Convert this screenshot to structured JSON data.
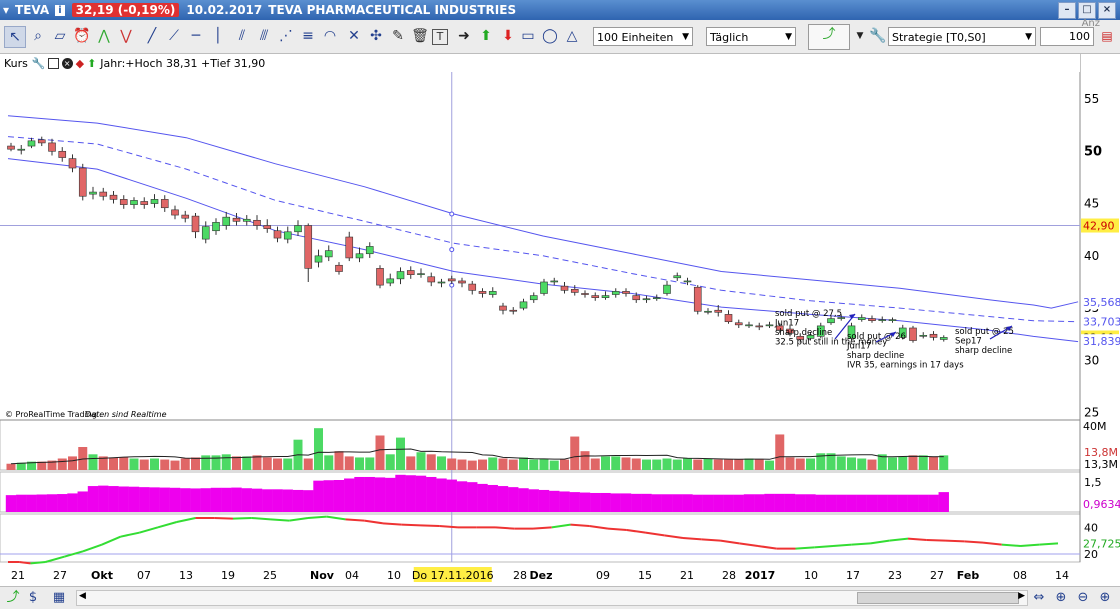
{
  "window": {
    "symbol": "TEVA",
    "price_badge": "32,19 (-0,19%)",
    "date": "10.02.2017",
    "instrument": "TEVA PHARMACEUTICAL INDUSTRIES"
  },
  "toolbar": {
    "units_select": "100 Einheiten",
    "period_select": "Täglich",
    "strategy_select": "Strategie [T0,S0]",
    "quantity_label": "Anz",
    "quantity_value": "100"
  },
  "chart_header": {
    "label": "Kurs",
    "year_stats": "Jahr:+Hoch 38,31 +Tief 31,90"
  },
  "watermark": "© ProRealTime Trading",
  "watermark_italic": "Daten sind Realtime",
  "colors": {
    "up": "#4cd964",
    "down": "#e06666",
    "band": "#5555ee",
    "volume_ma": "#222222",
    "indicator": "#ee00ee",
    "osc_up": "#33dd33",
    "osc_down": "#ee3333",
    "bg": "#ffffff",
    "grid": "#d8d8e8"
  },
  "chart_data": [
    {
      "type": "candlestick",
      "y_axis_ticks": [
        25,
        30,
        35,
        40,
        45,
        50,
        55
      ],
      "ylim": [
        24.3,
        57.2
      ],
      "price_labels": [
        {
          "value": 42.9,
          "text": "42,90",
          "style": "horizontal"
        },
        {
          "value": 35.568,
          "text": "35,568",
          "style": "band"
        },
        {
          "value": 33.703,
          "text": "33,703",
          "style": "band"
        },
        {
          "value": 32.19,
          "text": "32,19",
          "style": "last"
        },
        {
          "value": 31.839,
          "text": "31,839",
          "style": "band"
        }
      ],
      "horizontal_line": 42.9,
      "candles": [
        [
          50.5,
          50.2,
          50.8,
          50.0
        ],
        [
          50.1,
          50.2,
          50.6,
          49.7
        ],
        [
          50.5,
          51.0,
          51.3,
          50.3
        ],
        [
          51.1,
          50.8,
          51.4,
          50.5
        ],
        [
          50.8,
          50.0,
          51.2,
          49.6
        ],
        [
          50.0,
          49.4,
          50.4,
          49.0
        ],
        [
          49.3,
          48.4,
          49.7,
          48.0
        ],
        [
          48.4,
          45.7,
          48.8,
          45.3
        ],
        [
          45.9,
          46.1,
          46.6,
          45.4
        ],
        [
          46.1,
          45.7,
          46.5,
          45.3
        ],
        [
          45.8,
          45.4,
          46.2,
          45.0
        ],
        [
          45.4,
          44.9,
          45.8,
          44.5
        ],
        [
          44.9,
          45.3,
          45.6,
          44.5
        ],
        [
          45.2,
          44.9,
          45.6,
          44.5
        ],
        [
          45.0,
          45.4,
          45.9,
          44.6
        ],
        [
          45.4,
          44.6,
          45.8,
          44.2
        ],
        [
          44.4,
          43.9,
          44.8,
          43.5
        ],
        [
          43.9,
          43.6,
          44.3,
          43.2
        ],
        [
          43.8,
          42.3,
          44.1,
          41.7
        ],
        [
          41.6,
          42.8,
          43.3,
          41.2
        ],
        [
          42.4,
          43.2,
          43.6,
          42.0
        ],
        [
          42.9,
          43.7,
          44.2,
          42.5
        ],
        [
          43.6,
          43.3,
          44.1,
          42.9
        ],
        [
          43.3,
          43.5,
          43.9,
          42.9
        ],
        [
          43.4,
          42.9,
          43.9,
          42.5
        ],
        [
          42.9,
          42.6,
          43.5,
          42.2
        ],
        [
          42.4,
          41.7,
          42.8,
          41.3
        ],
        [
          41.6,
          42.3,
          42.8,
          41.2
        ],
        [
          42.3,
          42.9,
          43.4,
          41.9
        ],
        [
          42.9,
          38.8,
          43.1,
          37.5
        ],
        [
          39.4,
          40.0,
          40.6,
          38.9
        ],
        [
          39.9,
          40.5,
          41.0,
          39.5
        ],
        [
          39.1,
          38.5,
          39.4,
          38.2
        ],
        [
          41.8,
          39.8,
          42.3,
          39.5
        ],
        [
          39.8,
          40.2,
          40.8,
          39.4
        ],
        [
          40.2,
          40.9,
          41.3,
          39.8
        ],
        [
          38.8,
          37.2,
          39.1,
          36.9
        ],
        [
          37.4,
          37.8,
          38.3,
          37.1
        ],
        [
          37.8,
          38.5,
          38.9,
          37.3
        ],
        [
          38.6,
          38.2,
          39.0,
          37.8
        ],
        [
          38.3,
          38.3,
          38.8,
          37.9
        ],
        [
          38.0,
          37.5,
          38.4,
          37.1
        ],
        [
          37.4,
          37.5,
          37.8,
          37.0
        ],
        [
          37.8,
          37.6,
          38.1,
          37.3
        ],
        [
          37.6,
          37.4,
          37.9,
          37.0
        ],
        [
          37.3,
          36.7,
          37.6,
          36.3
        ],
        [
          36.6,
          36.4,
          36.9,
          36.0
        ],
        [
          36.3,
          36.6,
          37.0,
          36.0
        ],
        [
          35.2,
          34.8,
          35.5,
          34.4
        ],
        [
          34.8,
          34.7,
          35.1,
          34.4
        ],
        [
          35.0,
          35.6,
          35.9,
          34.8
        ],
        [
          35.8,
          36.2,
          36.5,
          35.5
        ],
        [
          36.4,
          37.5,
          37.8,
          36.2
        ],
        [
          37.5,
          37.6,
          37.9,
          37.2
        ],
        [
          37.1,
          36.7,
          37.5,
          36.4
        ],
        [
          36.8,
          36.5,
          37.2,
          36.2
        ],
        [
          36.4,
          36.3,
          36.7,
          36.0
        ],
        [
          36.2,
          36.0,
          36.5,
          35.7
        ],
        [
          36.0,
          36.2,
          36.6,
          35.8
        ],
        [
          36.3,
          36.6,
          36.9,
          36.0
        ],
        [
          36.6,
          36.4,
          36.9,
          36.1
        ],
        [
          36.2,
          35.8,
          36.5,
          35.5
        ],
        [
          35.8,
          35.9,
          36.2,
          35.5
        ],
        [
          35.9,
          36.0,
          36.3,
          35.7
        ],
        [
          36.4,
          37.2,
          37.6,
          36.2
        ],
        [
          37.9,
          38.1,
          38.4,
          37.6
        ],
        [
          37.6,
          37.6,
          37.9,
          37.2
        ],
        [
          37.0,
          34.7,
          37.2,
          34.4
        ],
        [
          34.7,
          34.7,
          35.0,
          34.4
        ],
        [
          34.8,
          34.6,
          35.3,
          34.2
        ],
        [
          34.4,
          33.7,
          34.8,
          33.5
        ],
        [
          33.6,
          33.4,
          33.9,
          33.1
        ],
        [
          33.4,
          33.4,
          33.7,
          33.1
        ],
        [
          33.3,
          33.2,
          33.6,
          32.9
        ],
        [
          33.4,
          33.4,
          33.7,
          33.1
        ],
        [
          33.3,
          32.9,
          33.6,
          32.6
        ],
        [
          33.0,
          32.6,
          33.3,
          32.3
        ],
        [
          32.3,
          32.0,
          32.6,
          31.7
        ],
        [
          32.1,
          32.4,
          32.7,
          31.9
        ],
        [
          32.3,
          33.3,
          33.6,
          32.1
        ],
        [
          33.6,
          34.0,
          34.3,
          33.4
        ],
        [
          34.0,
          34.1,
          34.4,
          33.8
        ],
        [
          32.1,
          33.3,
          33.6,
          31.9
        ],
        [
          33.9,
          34.1,
          34.4,
          33.7
        ],
        [
          34.0,
          33.8,
          34.3,
          33.6
        ],
        [
          33.9,
          33.9,
          34.2,
          33.6
        ],
        [
          33.8,
          33.9,
          34.1,
          33.6
        ],
        [
          32.2,
          33.1,
          33.4,
          32.0
        ],
        [
          33.1,
          31.9,
          33.3,
          31.7
        ],
        [
          32.4,
          32.4,
          32.7,
          32.1
        ],
        [
          32.5,
          32.2,
          32.8,
          31.9
        ],
        [
          32.0,
          32.2,
          32.4,
          31.8
        ]
      ],
      "upper_band": [
        [
          0,
          53.4
        ],
        [
          10,
          52.7
        ],
        [
          20,
          51.3
        ],
        [
          30,
          48.8
        ],
        [
          40,
          46.6
        ],
        [
          50,
          44.0
        ],
        [
          60,
          41.9
        ],
        [
          70,
          40.2
        ],
        [
          80,
          38.5
        ],
        [
          90,
          37.7
        ],
        [
          100,
          36.9
        ],
        [
          110,
          35.8
        ],
        [
          115,
          35.3
        ],
        [
          117,
          35.0
        ],
        [
          120,
          35.6
        ]
      ],
      "middle_band": [
        [
          0,
          51.4
        ],
        [
          10,
          50.7
        ],
        [
          20,
          48.3
        ],
        [
          30,
          45.3
        ],
        [
          40,
          43.3
        ],
        [
          50,
          41.2
        ],
        [
          60,
          40.0
        ],
        [
          70,
          38.3
        ],
        [
          80,
          36.7
        ],
        [
          90,
          35.7
        ],
        [
          100,
          35.0
        ],
        [
          110,
          34.2
        ],
        [
          115,
          33.8
        ],
        [
          120,
          33.7
        ]
      ],
      "lower_band": [
        [
          0,
          49.3
        ],
        [
          10,
          48.3
        ],
        [
          20,
          45.5
        ],
        [
          30,
          42.4
        ],
        [
          40,
          40.6
        ],
        [
          50,
          38.5
        ],
        [
          60,
          37.3
        ],
        [
          70,
          36.4
        ],
        [
          80,
          35.1
        ],
        [
          90,
          34.4
        ],
        [
          100,
          33.8
        ],
        [
          110,
          32.9
        ],
        [
          115,
          32.3
        ],
        [
          120,
          31.8
        ]
      ],
      "annotations": [
        {
          "lines": [
            "sold put @ 27,5",
            "Jun17",
            "sharp decline",
            "32.5 put still in the money"
          ]
        },
        {
          "lines": [
            "sold put @ 26",
            "Jun17",
            "sharp decline",
            "IVR 35, earnings in 17 days"
          ]
        },
        {
          "lines": [
            "sold put @ 25",
            "Sep17",
            "sharp decline"
          ]
        }
      ]
    },
    {
      "type": "bar",
      "name": "volume",
      "y_axis_ticks_text": [
        "40M"
      ],
      "labels": [
        "13,8M",
        "13,3M"
      ],
      "values": [
        6,
        7,
        8,
        8,
        9,
        11,
        13,
        22,
        15,
        13,
        12,
        12,
        11,
        10,
        11,
        10,
        9,
        11,
        12,
        14,
        14,
        15,
        13,
        13,
        14,
        12,
        11,
        11,
        29,
        11,
        40,
        14,
        18,
        13,
        12,
        12,
        33,
        15,
        31,
        13,
        17,
        15,
        13,
        11,
        10,
        9,
        10,
        12,
        11,
        10,
        12,
        10,
        11,
        9,
        10,
        32,
        18,
        11,
        13,
        13,
        12,
        11,
        10,
        10,
        11,
        10,
        11,
        10,
        11,
        10,
        10,
        10,
        11,
        10,
        9,
        34,
        12,
        11,
        11,
        16,
        16,
        13,
        12,
        11,
        10,
        15,
        12,
        13,
        14,
        14,
        13,
        14,
        13,
        40,
        16,
        13,
        11,
        11,
        40,
        15,
        14,
        14
      ]
    },
    {
      "type": "bar",
      "name": "indicator",
      "y_axis_ticks_text": [
        "1,5"
      ],
      "labels": [
        "0,9634"
      ],
      "values": [
        0.78,
        0.8,
        0.8,
        0.81,
        0.82,
        0.83,
        0.86,
        0.95,
        1.2,
        1.22,
        1.2,
        1.18,
        1.17,
        1.15,
        1.14,
        1.13,
        1.12,
        1.1,
        1.09,
        1.1,
        1.12,
        1.12,
        1.13,
        1.1,
        1.08,
        1.05,
        1.05,
        1.04,
        1.02,
        1.01,
        1.45,
        1.47,
        1.48,
        1.55,
        1.62,
        1.62,
        1.6,
        1.58,
        1.72,
        1.7,
        1.68,
        1.62,
        1.55,
        1.5,
        1.42,
        1.38,
        1.3,
        1.25,
        1.2,
        1.15,
        1.1,
        1.05,
        1.02,
        0.98,
        0.95,
        0.92,
        0.9,
        0.88,
        0.88,
        0.86,
        0.86,
        0.84,
        0.84,
        0.82,
        0.82,
        0.82,
        0.82,
        0.8,
        0.8,
        0.8,
        0.8,
        0.8,
        0.82,
        0.82,
        0.84,
        0.84,
        0.84,
        0.82,
        0.82,
        0.8,
        0.8,
        0.8,
        0.8,
        0.8,
        0.8,
        0.8,
        0.8,
        0.8,
        0.8,
        0.8,
        0.8,
        0.92,
        0.94,
        0.93,
        0.92,
        0.9,
        0.95,
        0.96,
        0.96,
        0.95,
        0.94,
        0.92,
        0.93
      ]
    },
    {
      "type": "line",
      "name": "oscillator",
      "y_axis_ticks": [
        20,
        40
      ],
      "ylim": [
        14,
        50
      ],
      "labels": [
        "27,725"
      ],
      "values": [
        [
          0,
          14
        ],
        [
          3,
          14
        ],
        [
          6,
          13
        ],
        [
          10,
          14
        ],
        [
          15,
          18
        ],
        [
          20,
          22
        ],
        [
          25,
          27
        ],
        [
          30,
          33
        ],
        [
          35,
          36
        ],
        [
          40,
          40
        ],
        [
          45,
          44
        ],
        [
          50,
          47
        ],
        [
          55,
          47
        ],
        [
          60,
          46.5
        ],
        [
          65,
          47
        ],
        [
          70,
          46
        ],
        [
          75,
          45
        ],
        [
          80,
          47
        ],
        [
          85,
          48
        ],
        [
          90,
          46
        ],
        [
          95,
          45
        ],
        [
          100,
          43
        ],
        [
          105,
          42
        ],
        [
          110,
          41.5
        ],
        [
          115,
          41
        ],
        [
          120,
          40
        ],
        [
          125,
          40
        ],
        [
          130,
          40
        ],
        [
          135,
          39
        ],
        [
          140,
          39
        ],
        [
          145,
          40
        ],
        [
          150,
          42
        ],
        [
          155,
          41
        ],
        [
          160,
          39
        ],
        [
          165,
          38
        ],
        [
          170,
          36
        ],
        [
          175,
          34
        ],
        [
          180,
          32
        ],
        [
          185,
          31
        ],
        [
          190,
          30
        ],
        [
          195,
          28
        ],
        [
          200,
          26
        ],
        [
          205,
          24
        ],
        [
          210,
          24
        ],
        [
          215,
          25
        ],
        [
          220,
          26
        ],
        [
          225,
          27
        ],
        [
          230,
          28
        ],
        [
          235,
          30
        ],
        [
          240,
          31.5
        ],
        [
          245,
          30.5
        ],
        [
          250,
          30
        ],
        [
          255,
          29.5
        ],
        [
          260,
          28.5
        ],
        [
          265,
          27
        ],
        [
          270,
          26
        ],
        [
          275,
          27
        ],
        [
          280,
          28
        ]
      ],
      "down_segments": [
        [
          50,
          58
        ],
        [
          88,
          145
        ],
        [
          148,
          210
        ],
        [
          240,
          262
        ]
      ]
    }
  ],
  "x_axis": {
    "ticks": [
      "21",
      "27",
      "Okt",
      "07",
      "13",
      "19",
      "25",
      "Nov",
      "04",
      "10",
      "16",
      "22",
      "28",
      "Dez",
      "09",
      "15",
      "21",
      "28",
      "2017",
      "10",
      "17",
      "23",
      "27",
      "Feb",
      "08",
      "14"
    ],
    "crosshair_label": "Do 17.11.2016"
  }
}
